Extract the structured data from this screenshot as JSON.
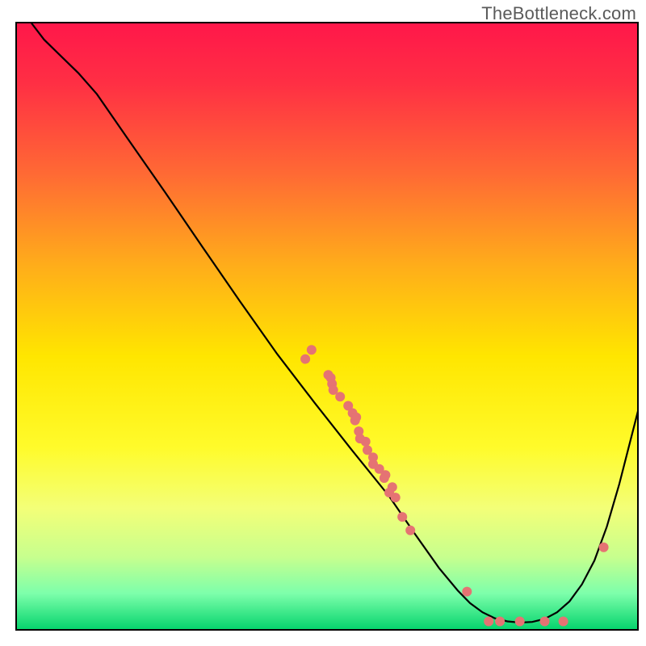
{
  "watermark": "TheBottleneck.com",
  "chart_data": {
    "type": "line",
    "title": "",
    "xlabel": "",
    "ylabel": "",
    "xlim": [
      0,
      100
    ],
    "ylim": [
      0,
      100
    ],
    "background_gradient": {
      "stops": [
        {
          "offset": 0.0,
          "color": "#ff174a"
        },
        {
          "offset": 0.1,
          "color": "#ff2f44"
        },
        {
          "offset": 0.25,
          "color": "#ff6a34"
        },
        {
          "offset": 0.4,
          "color": "#ffad1a"
        },
        {
          "offset": 0.55,
          "color": "#ffe600"
        },
        {
          "offset": 0.7,
          "color": "#fffb2b"
        },
        {
          "offset": 0.8,
          "color": "#f3ff78"
        },
        {
          "offset": 0.88,
          "color": "#c7ff8e"
        },
        {
          "offset": 0.94,
          "color": "#7dffab"
        },
        {
          "offset": 1.0,
          "color": "#04d36c"
        }
      ]
    },
    "series": [
      {
        "name": "bottleneck-curve",
        "type": "line",
        "color": "#000000",
        "points": [
          {
            "x": 2.4,
            "y": 100.0
          },
          {
            "x": 4.5,
            "y": 97.2
          },
          {
            "x": 7.0,
            "y": 94.7
          },
          {
            "x": 10.0,
            "y": 91.7
          },
          {
            "x": 13.0,
            "y": 88.2
          },
          {
            "x": 18.0,
            "y": 80.8
          },
          {
            "x": 24.0,
            "y": 72.0
          },
          {
            "x": 30.0,
            "y": 63.0
          },
          {
            "x": 36.0,
            "y": 54.1
          },
          {
            "x": 42.0,
            "y": 45.4
          },
          {
            "x": 48.0,
            "y": 37.4
          },
          {
            "x": 54.0,
            "y": 29.6
          },
          {
            "x": 60.0,
            "y": 22.0
          },
          {
            "x": 64.0,
            "y": 16.0
          },
          {
            "x": 68.0,
            "y": 10.2
          },
          {
            "x": 71.0,
            "y": 6.5
          },
          {
            "x": 73.0,
            "y": 4.4
          },
          {
            "x": 75.0,
            "y": 2.9
          },
          {
            "x": 77.0,
            "y": 1.9
          },
          {
            "x": 79.0,
            "y": 1.4
          },
          {
            "x": 81.0,
            "y": 1.2
          },
          {
            "x": 83.0,
            "y": 1.3
          },
          {
            "x": 85.0,
            "y": 1.8
          },
          {
            "x": 87.0,
            "y": 2.9
          },
          {
            "x": 89.0,
            "y": 4.7
          },
          {
            "x": 91.0,
            "y": 7.5
          },
          {
            "x": 93.0,
            "y": 11.4
          },
          {
            "x": 95.0,
            "y": 17.0
          },
          {
            "x": 97.0,
            "y": 24.0
          },
          {
            "x": 100.0,
            "y": 36.0
          }
        ]
      },
      {
        "name": "data-markers",
        "type": "scatter",
        "color": "#e57373",
        "radius": 6,
        "points": [
          {
            "x": 47.5,
            "y": 46.1
          },
          {
            "x": 46.5,
            "y": 44.6
          },
          {
            "x": 50.2,
            "y": 42.0
          },
          {
            "x": 50.6,
            "y": 41.5
          },
          {
            "x": 50.8,
            "y": 40.5
          },
          {
            "x": 51.0,
            "y": 39.5
          },
          {
            "x": 52.1,
            "y": 38.4
          },
          {
            "x": 53.4,
            "y": 36.9
          },
          {
            "x": 54.1,
            "y": 35.7
          },
          {
            "x": 54.7,
            "y": 35.0
          },
          {
            "x": 54.5,
            "y": 34.5
          },
          {
            "x": 55.1,
            "y": 32.7
          },
          {
            "x": 55.3,
            "y": 31.5
          },
          {
            "x": 56.2,
            "y": 31.0
          },
          {
            "x": 56.5,
            "y": 29.6
          },
          {
            "x": 57.4,
            "y": 28.4
          },
          {
            "x": 57.4,
            "y": 27.3
          },
          {
            "x": 58.4,
            "y": 26.5
          },
          {
            "x": 59.2,
            "y": 25.0
          },
          {
            "x": 59.4,
            "y": 25.5
          },
          {
            "x": 60.0,
            "y": 22.6
          },
          {
            "x": 61.0,
            "y": 21.8
          },
          {
            "x": 60.5,
            "y": 23.5
          },
          {
            "x": 62.1,
            "y": 18.6
          },
          {
            "x": 63.4,
            "y": 16.4
          },
          {
            "x": 72.5,
            "y": 6.3
          },
          {
            "x": 76.0,
            "y": 1.4
          },
          {
            "x": 77.8,
            "y": 1.4
          },
          {
            "x": 81.0,
            "y": 1.4
          },
          {
            "x": 85.0,
            "y": 1.4
          },
          {
            "x": 88.0,
            "y": 1.4
          },
          {
            "x": 94.5,
            "y": 13.6
          }
        ]
      }
    ]
  }
}
